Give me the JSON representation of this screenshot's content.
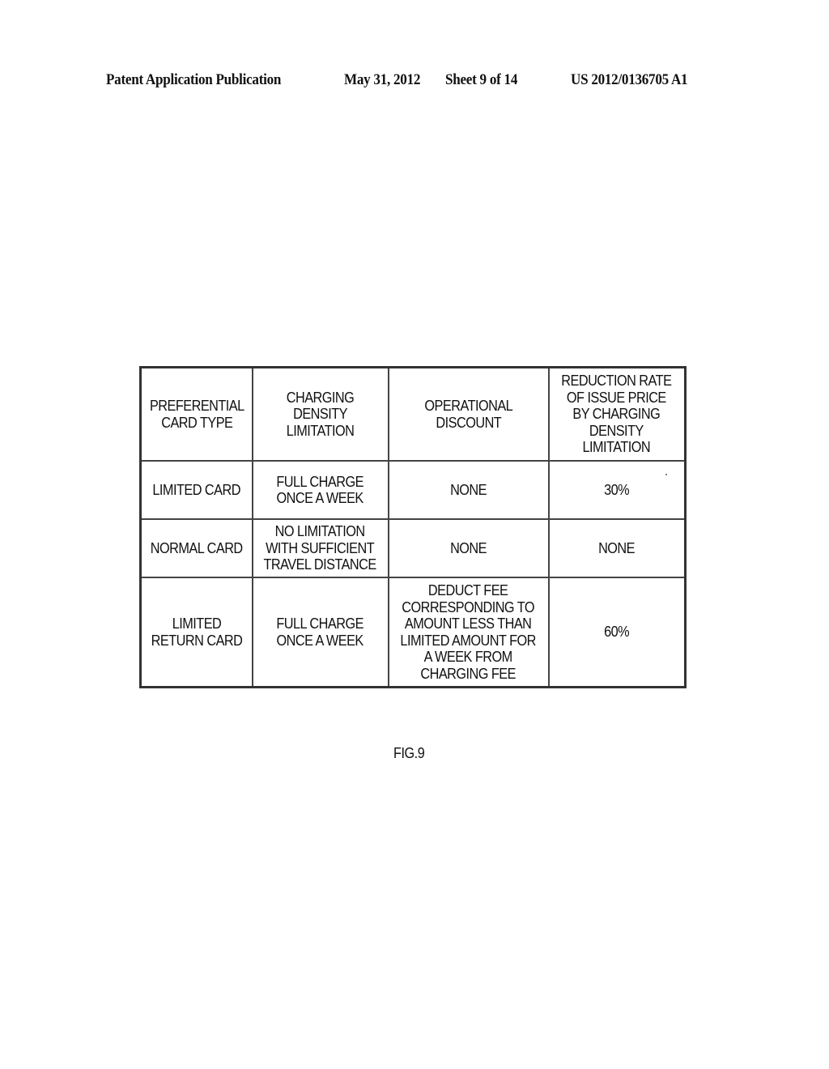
{
  "header": {
    "publication": "Patent Application Publication",
    "date": "May 31, 2012",
    "sheet": "Sheet 9 of 14",
    "number": "US 2012/0136705 A1"
  },
  "table": {
    "headers": [
      "PREFERENTIAL\nCARD TYPE",
      "CHARGING\nDENSITY\nLIMITATION",
      "OPERATIONAL\nDISCOUNT",
      "REDUCTION RATE\nOF ISSUE PRICE\nBY CHARGING\nDENSITY\nLIMITATION"
    ],
    "rows": [
      [
        "LIMITED CARD",
        "FULL CHARGE\nONCE A WEEK",
        "NONE",
        "30%"
      ],
      [
        "NORMAL CARD",
        "NO LIMITATION\nWITH SUFFICIENT\nTRAVEL DISTANCE",
        "NONE",
        "NONE"
      ],
      [
        "LIMITED\nRETURN CARD",
        "FULL CHARGE\nONCE A WEEK",
        "DEDUCT FEE\nCORRESPONDING TO\nAMOUNT LESS THAN\nLIMITED AMOUNT FOR\nA WEEK FROM\nCHARGING FEE",
        "60%"
      ]
    ]
  },
  "caption": "FIG.9"
}
